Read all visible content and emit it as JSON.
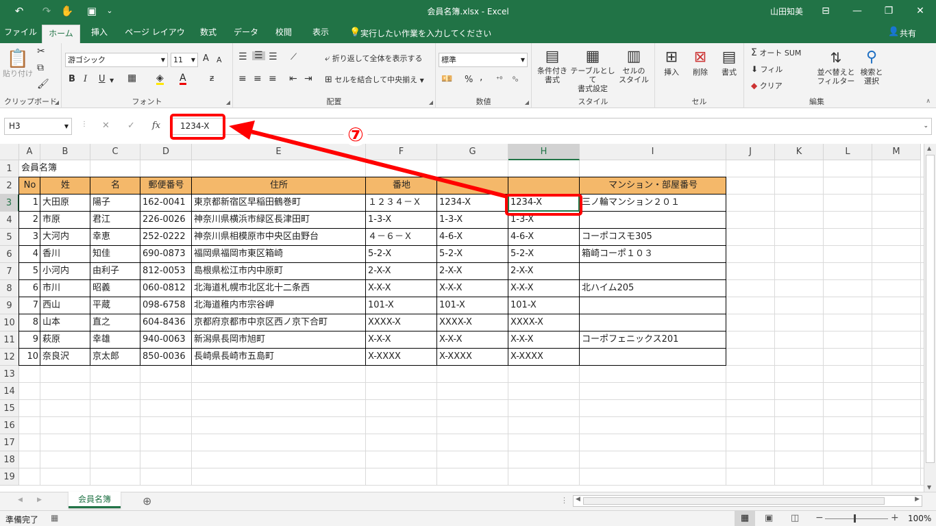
{
  "titlebar": {
    "title": "会員名簿.xlsx - Excel",
    "user": "山田知美",
    "undo_icon": "↶",
    "redo_icon": "↷",
    "touch_icon": "✋",
    "save_icon": "▣",
    "customize_icon": "⌄",
    "ribbon_display_icon": "⊟",
    "minimize_icon": "—",
    "restore_icon": "❐",
    "close_icon": "✕",
    "accent": "#217346"
  },
  "tabs": [
    "ファイル",
    "ホーム",
    "挿入",
    "ページ レイアウト",
    "数式",
    "データ",
    "校閲",
    "表示"
  ],
  "tell_me": "実行したい作業を入力してください",
  "share": "共有",
  "ribbon": {
    "clipboard": {
      "label": "クリップボード",
      "paste": "貼り付け"
    },
    "font": {
      "label": "フォント",
      "name": "游ゴシック",
      "size": "11",
      "grow": "A",
      "shrink": "A",
      "bold": "B",
      "italic": "I",
      "underline": "U"
    },
    "alignment": {
      "label": "配置",
      "wrap": "折り返して全体を表示する",
      "merge": "セルを結合して中央揃え"
    },
    "number": {
      "label": "数値",
      "format": "標準",
      "percent": "%",
      "comma": ","
    },
    "styles": {
      "label": "スタイル",
      "conditional": [
        "条件付き",
        "書式"
      ],
      "table": [
        "テーブルとして",
        "書式設定"
      ],
      "cell": [
        "セルの",
        "スタイル"
      ]
    },
    "cells": {
      "label": "セル",
      "insert": "挿入",
      "delete": "削除",
      "format": "書式"
    },
    "editing": {
      "label": "編集",
      "autosum": "オート SUM",
      "fill": "フィル",
      "clear": "クリア",
      "sort": [
        "並べ替えと",
        "フィルター"
      ],
      "find": [
        "検索と",
        "選択"
      ]
    }
  },
  "formula_bar": {
    "name_box": "H3",
    "cancel_icon": "✕",
    "enter_icon": "✓",
    "fx": "fx",
    "value": "1234-X"
  },
  "annotation": {
    "step_number": "⑦",
    "highlight_color": "#ff0000"
  },
  "columns": [
    "A",
    "B",
    "C",
    "D",
    "E",
    "F",
    "G",
    "H",
    "I",
    "J",
    "K",
    "L",
    "M"
  ],
  "rows": [
    "1",
    "2",
    "3",
    "4",
    "5",
    "6",
    "7",
    "8",
    "9",
    "10",
    "11",
    "12",
    "13",
    "14",
    "15",
    "16",
    "17",
    "18",
    "19"
  ],
  "selected_cell": {
    "column": "H",
    "row": "3"
  },
  "table": {
    "title": "会員名簿",
    "headers": [
      "No",
      "姓",
      "名",
      "郵便番号",
      "住所",
      "番地",
      "",
      "",
      "マンション・部屋番号"
    ],
    "header_fill": "#f4b86a",
    "rows": [
      [
        "1",
        "大田原",
        "陽子",
        "162-0041",
        "東京都新宿区早稲田鶴巻町",
        "１２３４－Ｘ",
        "1234-X",
        "1234-X",
        "三ノ輪マンション２０１"
      ],
      [
        "2",
        "市原",
        "君江",
        "226-0026",
        "神奈川県横浜市緑区長津田町",
        "1-3-X",
        "1-3-X",
        "1-3-X",
        ""
      ],
      [
        "3",
        "大河内",
        "幸恵",
        "252-0222",
        "神奈川県相模原市中央区由野台",
        "４－６－Ｘ",
        "4-6-X",
        "4-6-X",
        "コーポコスモ305"
      ],
      [
        "4",
        "香川",
        "知佳",
        "690-0873",
        "福岡県福岡市東区箱崎",
        "5-2-X",
        "5-2-X",
        "5-2-X",
        "箱崎コーポ１０３"
      ],
      [
        "5",
        "小河内",
        "由利子",
        "812-0053",
        "島根県松江市内中原町",
        "2-X-X",
        "2-X-X",
        "2-X-X",
        ""
      ],
      [
        "6",
        "市川",
        "昭義",
        "060-0812",
        "北海道札幌市北区北十二条西",
        "X-X-X",
        "X-X-X",
        "X-X-X",
        "北ハイム205"
      ],
      [
        "7",
        "西山",
        "平蔵",
        "098-6758",
        "北海道稚内市宗谷岬",
        "101-X",
        "101-X",
        "101-X",
        ""
      ],
      [
        "8",
        "山本",
        "直之",
        "604-8436",
        "京都府京都市中京区西ノ京下合町",
        "XXXX-X",
        "XXXX-X",
        "XXXX-X",
        ""
      ],
      [
        "9",
        "萩原",
        "幸雄",
        "940-0063",
        "新潟県長岡市旭町",
        "X-X-X",
        "X-X-X",
        "X-X-X",
        "コーポフェニックス201"
      ],
      [
        "10",
        "奈良沢",
        "京太郎",
        "850-0036",
        "長崎県長崎市五島町",
        "X-XXXX",
        "X-XXXX",
        "X-XXXX",
        ""
      ]
    ]
  },
  "sheet_tab": "会員名簿",
  "add_sheet_icon": "⊕",
  "status": {
    "ready": "準備完了",
    "zoom": "100%",
    "zoom_out": "−",
    "zoom_in": "+"
  }
}
